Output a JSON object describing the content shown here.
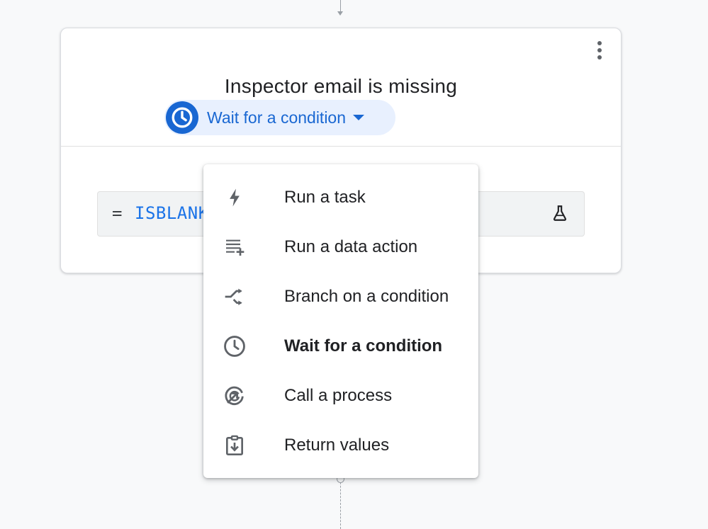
{
  "card": {
    "title": "Inspector email is missing",
    "step_type": {
      "label": "Wait for a condition",
      "icon": "clock-icon",
      "accent_color": "#1967d2"
    },
    "formula": {
      "operator": "=",
      "text": "ISBLANK"
    }
  },
  "step_menu": {
    "items": [
      {
        "label": "Run a task",
        "icon": "bolt-icon",
        "selected": false
      },
      {
        "label": "Run a data action",
        "icon": "playlist-add-icon",
        "selected": false
      },
      {
        "label": "Branch on a condition",
        "icon": "branch-icon",
        "selected": false
      },
      {
        "label": "Wait for a condition",
        "icon": "clock-icon",
        "selected": true
      },
      {
        "label": "Call a process",
        "icon": "call-process-icon",
        "selected": false
      },
      {
        "label": "Return values",
        "icon": "clipboard-download-icon",
        "selected": false
      }
    ]
  }
}
